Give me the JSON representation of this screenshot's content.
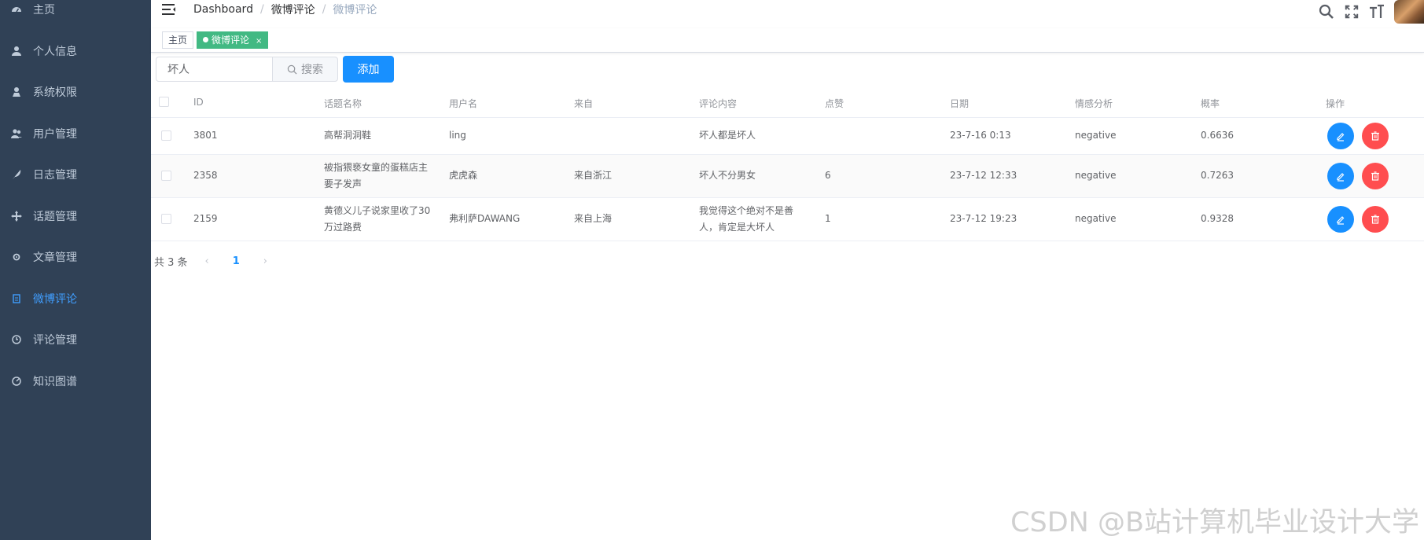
{
  "sidebar": {
    "items": [
      {
        "label": "主页",
        "icon": "dashboard-icon"
      },
      {
        "label": "个人信息",
        "icon": "user-icon"
      },
      {
        "label": "系统权限",
        "icon": "permission-icon"
      },
      {
        "label": "用户管理",
        "icon": "users-icon"
      },
      {
        "label": "日志管理",
        "icon": "feather-icon"
      },
      {
        "label": "话题管理",
        "icon": "move-icon"
      },
      {
        "label": "文章管理",
        "icon": "gear-icon"
      },
      {
        "label": "微博评论",
        "icon": "document-icon",
        "active": true
      },
      {
        "label": "评论管理",
        "icon": "clock-icon"
      },
      {
        "label": "知识图谱",
        "icon": "chart-icon"
      }
    ]
  },
  "navbar": {
    "breadcrumb": [
      "Dashboard",
      "微博评论",
      "微博评论"
    ]
  },
  "tags": {
    "home": "主页",
    "active": "微博评论",
    "close": "×"
  },
  "toolbar": {
    "search_value": "坏人",
    "search_label": "搜索",
    "add_label": "添加"
  },
  "table": {
    "headers": [
      "ID",
      "话题名称",
      "用户名",
      "来自",
      "评论内容",
      "点赞",
      "日期",
      "情感分析",
      "概率",
      "操作"
    ],
    "rows": [
      {
        "id": "3801",
        "topic": "高帮洞洞鞋",
        "user": "ling",
        "from": "",
        "content": "坏人都是坏人",
        "likes": "",
        "date": "23-7-16 0:13",
        "sentiment": "negative",
        "prob": "0.6636"
      },
      {
        "id": "2358",
        "topic": "被指猥亵女童的蛋糕店主要子发声",
        "user": "虎虎森",
        "from": "来自浙江",
        "content": "坏人不分男女",
        "likes": "6",
        "date": "23-7-12 12:33",
        "sentiment": "negative",
        "prob": "0.7263"
      },
      {
        "id": "2159",
        "topic": "黄德义儿子说家里收了30万过路费",
        "user": "弗利萨DAWANG",
        "from": "来自上海",
        "content": "我觉得这个绝对不是善人，肯定是大坏人",
        "likes": "1",
        "date": "23-7-12 19:23",
        "sentiment": "negative",
        "prob": "0.9328"
      }
    ]
  },
  "pagination": {
    "total_text": "共 3 条",
    "current_page": "1",
    "prev": "‹",
    "next": "›"
  },
  "watermark": "CSDN @B站计算机毕业设计大学",
  "colors": {
    "sidebar_bg": "#304156",
    "sidebar_active": "#409eff",
    "primary": "#1890ff",
    "danger": "#ff4d4f",
    "tag_active": "#42b983"
  }
}
